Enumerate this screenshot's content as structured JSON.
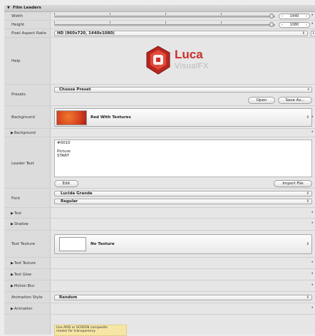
{
  "header": {
    "title": "Film Leaders"
  },
  "width": {
    "label": "Width",
    "value": "1440"
  },
  "height": {
    "label": "Height",
    "value": "1080"
  },
  "pixel_aspect": {
    "label": "Pixel Aspect Ratio",
    "value": "HD (960x720, 1440x1080)"
  },
  "help": {
    "label": "Help",
    "logo_main": "Luca",
    "logo_sub": "VisualFX"
  },
  "presets": {
    "label": "Presets",
    "value": "Choose Preset",
    "open": "Open",
    "save": "Save As..."
  },
  "background": {
    "label": "Background",
    "texture_name": "Red With Textures",
    "disclosure": "Background"
  },
  "leader_text": {
    "label": "Leader Text",
    "lines": [
      "#0010",
      "",
      "Picture",
      "START"
    ],
    "edit": "Edit",
    "import": "Import File"
  },
  "font": {
    "label": "Font",
    "family": "Lucida Grande",
    "style": "Regular"
  },
  "text_disc": "Text",
  "shadow_disc": "Shadow",
  "text_texture": {
    "label": "Text Texture",
    "value": "No Texture"
  },
  "text_texture_disc": "Text Texture",
  "text_glow_disc": "Text Glow",
  "motion_blur_disc": "Motion Blur",
  "animation_style": {
    "label": "Animation Style",
    "value": "Random"
  },
  "animation_disc": "Animation",
  "note": {
    "lines": [
      "Use ADD or SCREEN composite",
      "modes for transparency"
    ]
  },
  "colors": {
    "accent_red": "#d0342c",
    "swatch_red": "#d9451f"
  }
}
